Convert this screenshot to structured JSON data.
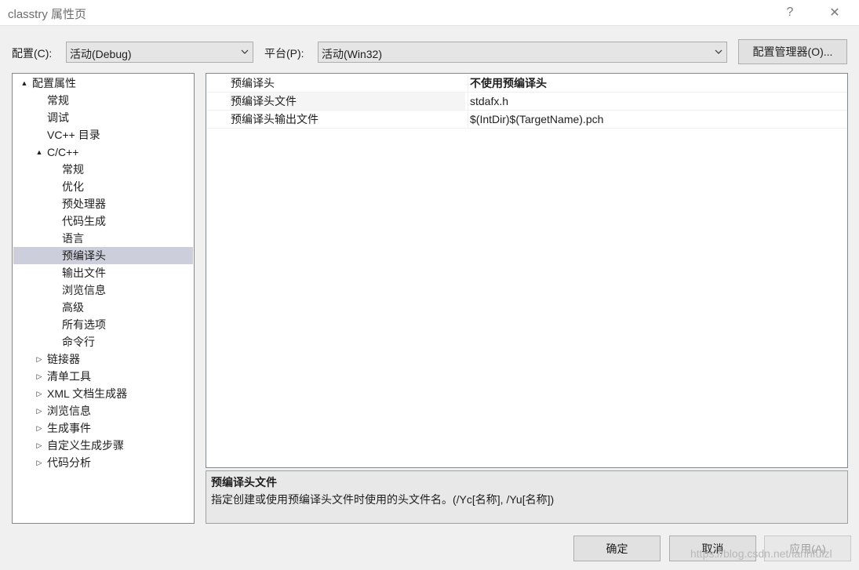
{
  "window": {
    "title": "classtry 属性页",
    "help_glyph": "?",
    "close_glyph": "✕"
  },
  "toolbar": {
    "config_label": "配置(C):",
    "config_value": "活动(Debug)",
    "platform_label": "平台(P):",
    "platform_value": "活动(Win32)",
    "config_manager_label": "配置管理器(O)..."
  },
  "tree": {
    "items": [
      {
        "label": "配置属性",
        "arrow": "▲",
        "level": 0,
        "expanded": true
      },
      {
        "label": "常规",
        "level": 1
      },
      {
        "label": "调试",
        "level": 1
      },
      {
        "label": "VC++ 目录",
        "level": 1
      },
      {
        "label": "C/C++",
        "arrow": "▲",
        "level": 1,
        "expanded": true
      },
      {
        "label": "常规",
        "level": 2
      },
      {
        "label": "优化",
        "level": 2
      },
      {
        "label": "预处理器",
        "level": 2
      },
      {
        "label": "代码生成",
        "level": 2
      },
      {
        "label": "语言",
        "level": 2
      },
      {
        "label": "预编译头",
        "level": 2,
        "selected": true
      },
      {
        "label": "输出文件",
        "level": 2
      },
      {
        "label": "浏览信息",
        "level": 2
      },
      {
        "label": "高级",
        "level": 2
      },
      {
        "label": "所有选项",
        "level": 2
      },
      {
        "label": "命令行",
        "level": 2
      },
      {
        "label": "链接器",
        "arrow": "▷",
        "level": 1
      },
      {
        "label": "清单工具",
        "arrow": "▷",
        "level": 1
      },
      {
        "label": "XML 文档生成器",
        "arrow": "▷",
        "level": 1
      },
      {
        "label": "浏览信息",
        "arrow": "▷",
        "level": 1
      },
      {
        "label": "生成事件",
        "arrow": "▷",
        "level": 1
      },
      {
        "label": "自定义生成步骤",
        "arrow": "▷",
        "level": 1
      },
      {
        "label": "代码分析",
        "arrow": "▷",
        "level": 1
      }
    ]
  },
  "properties": {
    "rows": [
      {
        "name": "预编译头",
        "value": "不使用预编译头",
        "bold": true
      },
      {
        "name": "预编译头文件",
        "value": "stdafx.h"
      },
      {
        "name": "预编译头输出文件",
        "value": "$(IntDir)$(TargetName).pch"
      }
    ]
  },
  "description": {
    "title": "预编译头文件",
    "text": "指定创建或使用预编译头文件时使用的头文件名。(/Yc[名称], /Yu[名称])"
  },
  "buttons": {
    "ok": "确定",
    "cancel": "取消",
    "apply": "应用(A)"
  },
  "watermark": "https://blog.csdn.net/lanhfulzl",
  "colors": {
    "selection": "#cccedb",
    "background": "#f0f0f0"
  }
}
